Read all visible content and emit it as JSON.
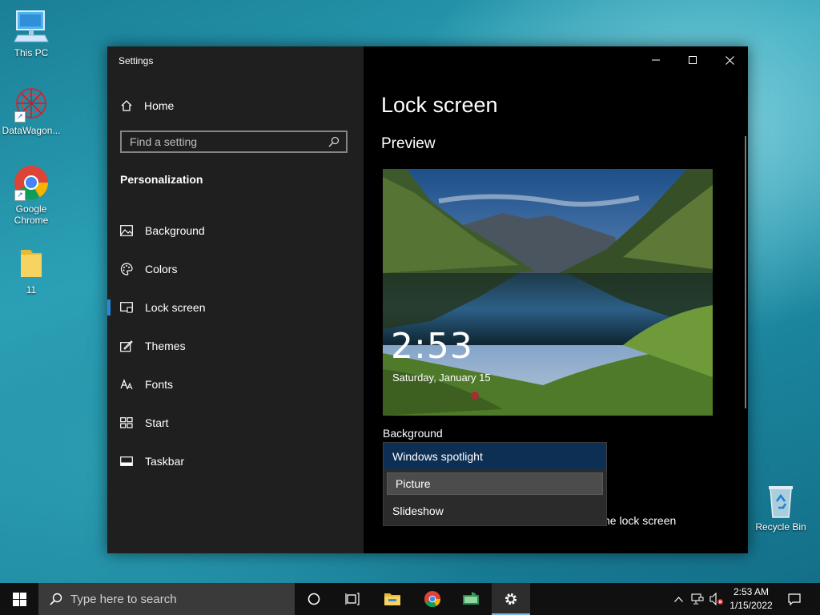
{
  "desktop": {
    "icons": [
      {
        "label": "This PC"
      },
      {
        "label": "DataWagon..."
      },
      {
        "label": "Google Chrome"
      },
      {
        "label": "11"
      },
      {
        "label": "Recycle Bin"
      }
    ]
  },
  "window": {
    "title": "Settings",
    "sidebar": {
      "home_label": "Home",
      "search_placeholder": "Find a setting",
      "section": "Personalization",
      "items": [
        {
          "label": "Background",
          "icon": "picture-icon"
        },
        {
          "label": "Colors",
          "icon": "palette-icon"
        },
        {
          "label": "Lock screen",
          "icon": "lock-screen-icon",
          "active": true
        },
        {
          "label": "Themes",
          "icon": "themes-icon"
        },
        {
          "label": "Fonts",
          "icon": "fonts-icon"
        },
        {
          "label": "Start",
          "icon": "start-icon"
        },
        {
          "label": "Taskbar",
          "icon": "taskbar-icon"
        }
      ]
    },
    "main": {
      "title": "Lock screen",
      "preview_heading": "Preview",
      "preview_time": "2:53",
      "preview_date": "Saturday, January 15",
      "background_label": "Background",
      "dropdown_options": [
        "Windows spotlight",
        "Picture",
        "Slideshow"
      ],
      "partial_text": "he lock screen"
    }
  },
  "taskbar": {
    "search_placeholder": "Type here to search",
    "time": "2:53 AM",
    "date": "1/15/2022"
  },
  "colors": {
    "accent": "#2b88d8",
    "selected_option": "#0c2f53",
    "sidebar_bg": "#1f1f1f"
  }
}
